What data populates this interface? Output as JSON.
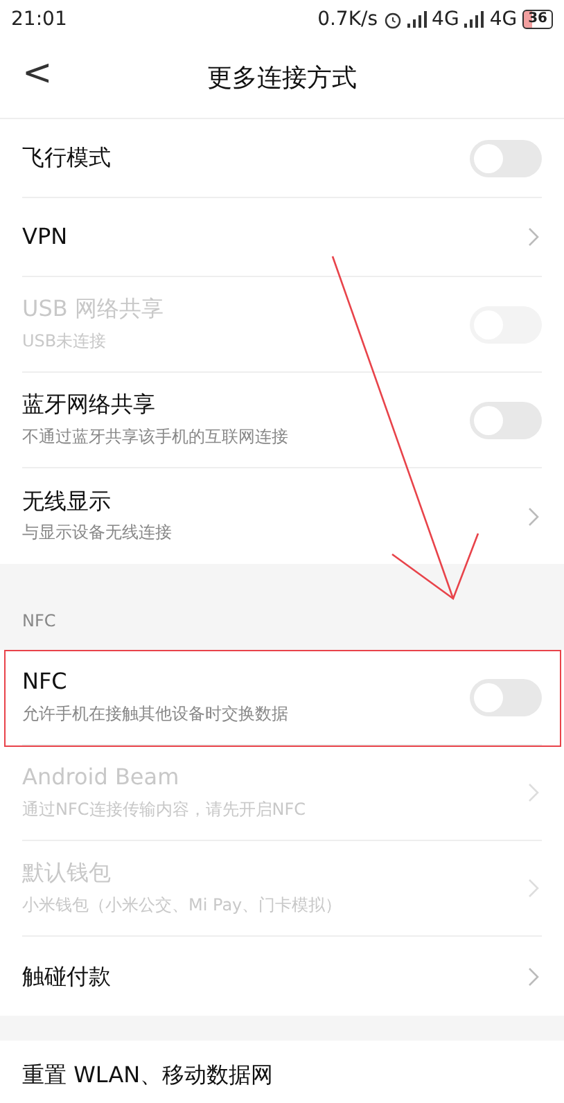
{
  "status_bar": {
    "time": "21:01",
    "speed": "0.7K/s",
    "network_1": "4G",
    "network_2": "4G",
    "battery": "36"
  },
  "header": {
    "back": "<",
    "title": "更多连接方式"
  },
  "groups": [
    {
      "items": [
        {
          "title": "飞行模式",
          "kind": "toggle",
          "on": false,
          "disabled": false
        },
        {
          "title": "VPN",
          "kind": "link",
          "disabled": false
        },
        {
          "title": "USB 网络共享",
          "subtitle": "USB未连接",
          "kind": "toggle",
          "on": false,
          "disabled": true
        },
        {
          "title": "蓝牙网络共享",
          "subtitle": "不通过蓝牙共享该手机的互联网连接",
          "kind": "toggle",
          "on": false,
          "disabled": false
        },
        {
          "title": "无线显示",
          "subtitle": "与显示设备无线连接",
          "kind": "link",
          "disabled": false
        }
      ]
    },
    {
      "label": "NFC",
      "items": [
        {
          "title": "NFC",
          "subtitle": "允许手机在接触其他设备时交换数据",
          "kind": "toggle",
          "on": false,
          "disabled": false,
          "highlighted": true
        },
        {
          "title": "Android Beam",
          "subtitle": "通过NFC连接传输内容，请先开启NFC",
          "kind": "link",
          "disabled": true
        },
        {
          "title": "默认钱包",
          "subtitle": "小米钱包（小米公交、Mi Pay、门卡模拟）",
          "kind": "link",
          "disabled": true
        },
        {
          "title": "触碰付款",
          "kind": "link",
          "disabled": false
        }
      ]
    },
    {
      "items": [
        {
          "title": "重置 WLAN、移动数据网",
          "kind": "plain",
          "disabled": false
        }
      ]
    }
  ],
  "annotation": {
    "kind": "arrow"
  }
}
